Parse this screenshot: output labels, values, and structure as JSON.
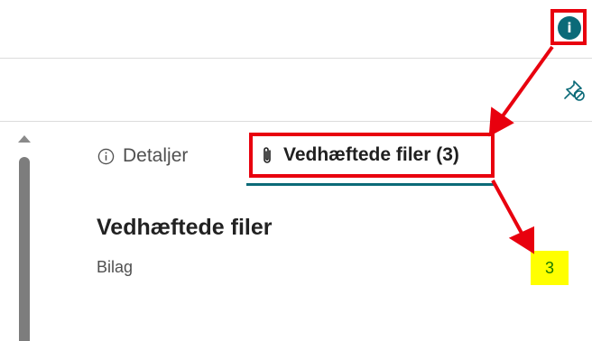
{
  "header": {
    "info_button_icon": "info-filled-icon",
    "info_button_symbol": "i"
  },
  "toolbar": {
    "pin_icon": "pin-off-icon"
  },
  "tabs": [
    {
      "label": "Detaljer",
      "icon": "info-outline-icon",
      "active": false
    },
    {
      "label": "Vedhæftede filer (3)",
      "icon": "paperclip-icon",
      "active": true
    }
  ],
  "attachments": {
    "title": "Vedhæftede filer",
    "rows": [
      {
        "label": "Bilag",
        "count": "3"
      }
    ]
  },
  "colors": {
    "accent": "#0b6a78",
    "highlight_red": "#e8000e",
    "badge_yellow": "#ffff00",
    "count_text": "#1a7a00"
  }
}
